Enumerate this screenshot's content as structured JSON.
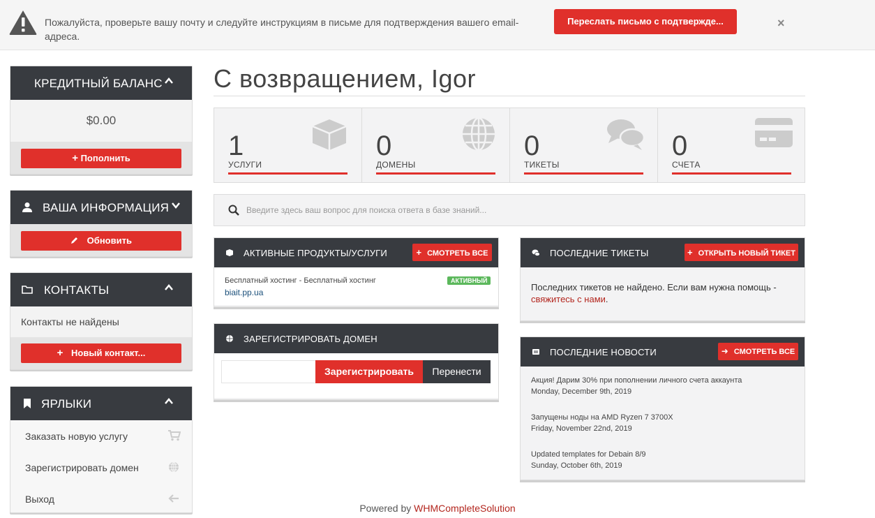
{
  "alert": {
    "message": "Пожалуйста, проверьте вашу почту и следуйте инструкциям в письме для подтверждения вашего email-адреса.",
    "resend_label": "Переслать письмо с подтвержде...",
    "close_glyph": "×"
  },
  "sidebar": {
    "credit": {
      "title": "КРЕДИТНЫЙ БАЛАНС",
      "amount": "$0.00",
      "button": "Пополнить"
    },
    "info": {
      "title": "ВАША ИНФОРМАЦИЯ",
      "button": "Обновить"
    },
    "contacts": {
      "title": "КОНТАКТЫ",
      "empty": "Контакты не найдены",
      "button": "Новый контакт..."
    },
    "shortcuts": {
      "title": "ЯРЛЫКИ",
      "items": [
        {
          "label": "Заказать новую услугу",
          "icon": "cart-icon"
        },
        {
          "label": "Зарегистрировать домен",
          "icon": "globe-icon"
        },
        {
          "label": "Выход",
          "icon": "arrow-left-icon"
        }
      ]
    }
  },
  "main": {
    "welcome": "С возвращением, Igor",
    "stats": [
      {
        "count": "1",
        "label": "УСЛУГИ",
        "icon": "cube-icon"
      },
      {
        "count": "0",
        "label": "ДОМЕНЫ",
        "icon": "globe-icon"
      },
      {
        "count": "0",
        "label": "ТИКЕТЫ",
        "icon": "comments-icon"
      },
      {
        "count": "0",
        "label": "СЧЕТА",
        "icon": "credit-card-icon"
      }
    ],
    "kb_search_placeholder": "Введите здесь ваш вопрос для поиска ответа в базе знаний...",
    "products": {
      "title": "АКТИВНЫЕ ПРОДУКТЫ/УСЛУГИ",
      "button": "СМОТРЕТЬ ВСЕ",
      "item_name": "Бесплатный хостинг - Бесплатный хостинг",
      "item_domain": "biait.pp.ua",
      "item_status": "АКТИВНЫЙ"
    },
    "domain": {
      "title": "ЗАРЕГИСТРИРОВАТЬ ДОМЕН",
      "register_label": "Зарегистрировать",
      "transfer_label": "Перенести",
      "input_value": ""
    },
    "tickets": {
      "title": "ПОСЛЕДНИЕ ТИКЕТЫ",
      "button": "ОТКРЫТЬ НОВЫЙ ТИКЕТ",
      "empty_text": "Последних тикетов не найдено. Если вам нужна помощь -",
      "contact_link": "свяжитесь с нами",
      "period": "."
    },
    "news": {
      "title": "ПОСЛЕДНИЕ НОВОСТИ",
      "button": "СМОТРЕТЬ ВСЕ",
      "items": [
        {
          "title": "Акция! Дарим 30% при пополнении личного счета аккаунта",
          "date": "Monday, December 9th, 2019"
        },
        {
          "title": "Запущены ноды на AMD Ryzen 7 3700X",
          "date": "Friday, November 22nd, 2019"
        },
        {
          "title": "Updated templates for Debain 8/9",
          "date": "Sunday, October 6th, 2019"
        }
      ]
    }
  },
  "footer": {
    "prefix": "Powered by",
    "link": "WHMCompleteSolution"
  },
  "colors": {
    "accent": "#e0302b",
    "header_dark": "#383b40",
    "status_green": "#5cb85c"
  }
}
